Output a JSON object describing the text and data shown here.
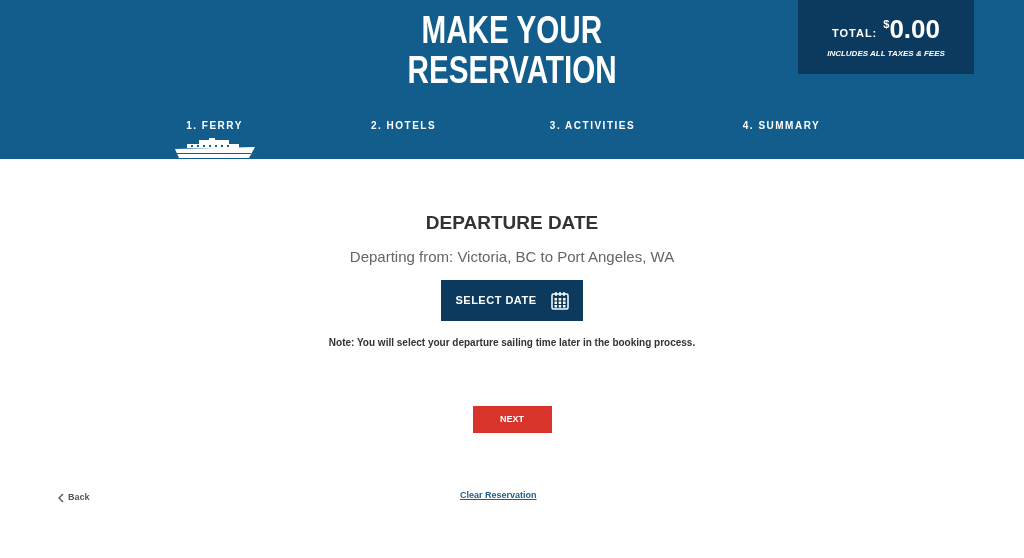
{
  "header": {
    "title_lines": [
      "MAKE YOUR",
      "RESERVATION"
    ],
    "total": {
      "label": "TOTAL:",
      "currency": "$",
      "amount": "0.00",
      "note": "INCLUDES ALL TAXES & FEES"
    }
  },
  "steps": [
    {
      "label": "1. FERRY",
      "selected": true
    },
    {
      "label": "2. HOTELS",
      "selected": false
    },
    {
      "label": "3. ACTIVITIES",
      "selected": false
    },
    {
      "label": "4. SUMMARY",
      "selected": false
    }
  ],
  "section": {
    "heading": "DEPARTURE DATE",
    "route": "Departing from: Victoria, BC to Port Angeles, WA",
    "select_button": "SELECT DATE",
    "note": "Note: You will select your departure sailing time later in the booking process."
  },
  "next_button": "NEXT",
  "back_link": "Back",
  "clear_link": "Clear Reservation"
}
